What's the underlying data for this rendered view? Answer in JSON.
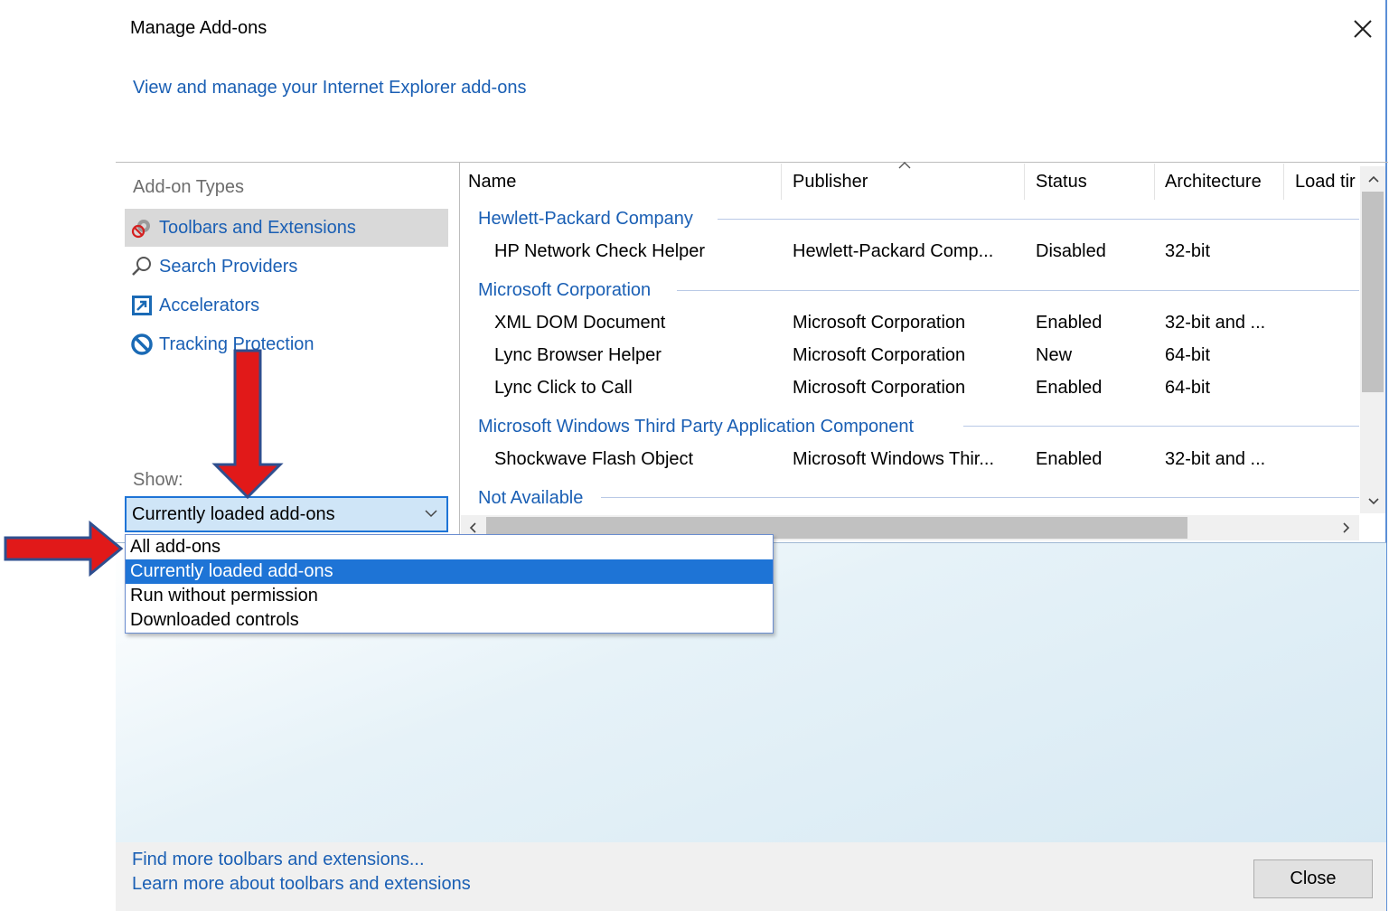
{
  "window": {
    "title": "Manage Add-ons",
    "subtitle": "View and manage your Internet Explorer add-ons"
  },
  "sidebar": {
    "types_label": "Add-on Types",
    "items": [
      {
        "label": "Toolbars and Extensions",
        "icon": "gear-icon",
        "selected": true
      },
      {
        "label": "Search Providers",
        "icon": "search-icon",
        "selected": false
      },
      {
        "label": "Accelerators",
        "icon": "accelerator-icon",
        "selected": false
      },
      {
        "label": "Tracking Protection",
        "icon": "block-icon",
        "selected": false
      }
    ],
    "show_label": "Show:",
    "show_value": "Currently loaded add-ons",
    "show_options": [
      "All add-ons",
      "Currently loaded add-ons",
      "Run without permission",
      "Downloaded controls"
    ]
  },
  "table": {
    "columns": [
      "Name",
      "Publisher",
      "Status",
      "Architecture",
      "Load tir"
    ],
    "groups": [
      {
        "name": "Hewlett-Packard Company",
        "rows": [
          {
            "name": "HP Network Check Helper",
            "publisher": "Hewlett-Packard Comp...",
            "status": "Disabled",
            "arch": "32-bit"
          }
        ]
      },
      {
        "name": "Microsoft Corporation",
        "rows": [
          {
            "name": "XML DOM Document",
            "publisher": "Microsoft Corporation",
            "status": "Enabled",
            "arch": "32-bit and ..."
          },
          {
            "name": "Lync Browser Helper",
            "publisher": "Microsoft Corporation",
            "status": "New",
            "arch": "64-bit"
          },
          {
            "name": "Lync Click to Call",
            "publisher": "Microsoft Corporation",
            "status": "Enabled",
            "arch": "64-bit"
          }
        ]
      },
      {
        "name": "Microsoft Windows Third Party Application Component",
        "rows": [
          {
            "name": "Shockwave Flash Object",
            "publisher": "Microsoft Windows Thir...",
            "status": "Enabled",
            "arch": "32-bit and ..."
          }
        ]
      },
      {
        "name": "Not Available",
        "rows": []
      }
    ]
  },
  "footer": {
    "link1": "Find more toolbars and extensions...",
    "link2": "Learn more about toolbars and extensions",
    "close_label": "Close"
  },
  "colors": {
    "link": "#1a5fb4",
    "selection": "#1e74d6",
    "annotation_arrow": "#e11919"
  }
}
